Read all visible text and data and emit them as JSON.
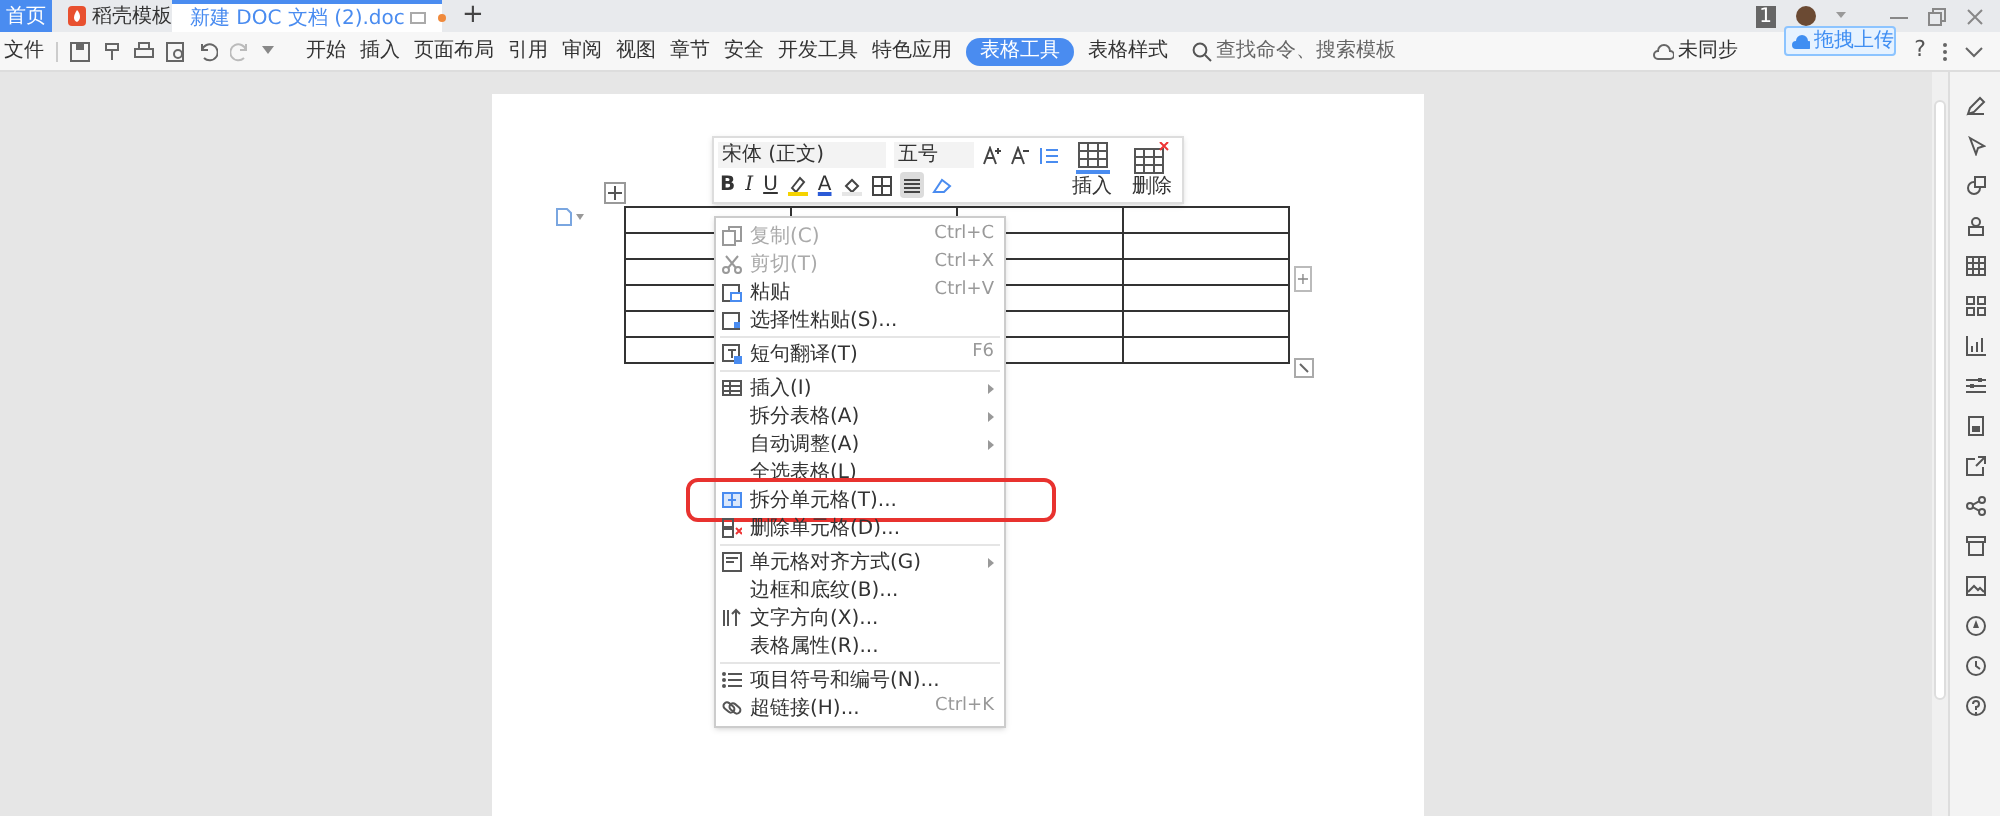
{
  "tabs": [
    {
      "label": "首页",
      "selected": false,
      "kind": "home"
    },
    {
      "label": "稻壳模板",
      "selected": false,
      "kind": "docer"
    },
    {
      "label": "新建 DOC 文档 (2).doc",
      "selected": true,
      "kind": "doc"
    }
  ],
  "new_tab": "+",
  "add_column": "+",
  "account": {
    "badge": "1"
  },
  "toolbar": {
    "file_menu": "文件",
    "ribbon_tabs": [
      {
        "label": "开始",
        "selected": false
      },
      {
        "label": "插入",
        "selected": false
      },
      {
        "label": "页面布局",
        "selected": false
      },
      {
        "label": "引用",
        "selected": false
      },
      {
        "label": "审阅",
        "selected": false
      },
      {
        "label": "视图",
        "selected": false
      },
      {
        "label": "章节",
        "selected": false
      },
      {
        "label": "安全",
        "selected": false
      },
      {
        "label": "开发工具",
        "selected": false
      },
      {
        "label": "特色应用",
        "selected": false
      },
      {
        "label": "表格工具",
        "selected": true
      },
      {
        "label": "表格样式",
        "selected": false
      }
    ],
    "search": {
      "placeholder": "查找命令、搜索模板"
    },
    "sync": "未同步",
    "help": "?"
  },
  "upload_popup": {
    "label": "拖拽上传"
  },
  "mini_toolbar": {
    "font": "宋体 (正文)",
    "size": "五号",
    "insert": "插入",
    "delete": "删除",
    "buttons": [
      {
        "kind": "bold",
        "label": "B",
        "selected": false
      },
      {
        "kind": "italic",
        "label": "I",
        "selected": false
      },
      {
        "kind": "underline",
        "label": "U",
        "selected": false
      },
      {
        "kind": "highlight",
        "selected": false
      },
      {
        "kind": "font_color",
        "label": "A",
        "selected": false
      },
      {
        "kind": "shading",
        "selected": false
      },
      {
        "kind": "borders",
        "selected": false
      },
      {
        "kind": "align",
        "selected": true
      },
      {
        "kind": "eraser",
        "selected": false
      }
    ]
  },
  "context_menu": {
    "items": [
      {
        "kind": "item",
        "label": "复制(C)",
        "shortcut": "Ctrl+C",
        "disabled": true,
        "submenu": false,
        "highlighted": false
      },
      {
        "kind": "item",
        "label": "剪切(T)",
        "shortcut": "Ctrl+X",
        "disabled": true,
        "submenu": false,
        "highlighted": false
      },
      {
        "kind": "item",
        "label": "粘贴",
        "shortcut": "Ctrl+V",
        "disabled": false,
        "submenu": false,
        "highlighted": false
      },
      {
        "kind": "item",
        "label": "选择性粘贴(S)...",
        "disabled": false,
        "submenu": false,
        "highlighted": false
      },
      {
        "kind": "separator"
      },
      {
        "kind": "item",
        "label": "短句翻译(T)",
        "shortcut": "F6",
        "disabled": false,
        "submenu": false,
        "highlighted": false
      },
      {
        "kind": "separator"
      },
      {
        "kind": "item",
        "label": "插入(I)",
        "disabled": false,
        "submenu": true,
        "highlighted": false
      },
      {
        "kind": "item",
        "label": "拆分表格(A)",
        "disabled": false,
        "submenu": true,
        "highlighted": false
      },
      {
        "kind": "item",
        "label": "自动调整(A)",
        "disabled": false,
        "submenu": true,
        "highlighted": false
      },
      {
        "kind": "item",
        "label": "全选表格(L)",
        "disabled": false,
        "submenu": false,
        "highlighted": false
      },
      {
        "kind": "item",
        "label": "拆分单元格(T)...",
        "disabled": false,
        "submenu": false,
        "highlighted": true
      },
      {
        "kind": "item",
        "label": "删除单元格(D)...",
        "disabled": false,
        "submenu": false,
        "highlighted": false
      },
      {
        "kind": "separator"
      },
      {
        "kind": "item",
        "label": "单元格对齐方式(G)",
        "disabled": false,
        "submenu": true,
        "highlighted": false
      },
      {
        "kind": "item",
        "label": "边框和底纹(B)...",
        "disabled": false,
        "submenu": false,
        "highlighted": false
      },
      {
        "kind": "item",
        "label": "文字方向(X)...",
        "disabled": false,
        "submenu": false,
        "highlighted": false
      },
      {
        "kind": "item",
        "label": "表格属性(R)...",
        "disabled": false,
        "submenu": false,
        "highlighted": false
      },
      {
        "kind": "separator"
      },
      {
        "kind": "item",
        "label": "项目符号和编号(N)...",
        "disabled": false,
        "submenu": false,
        "highlighted": false
      },
      {
        "kind": "item",
        "label": "超链接(H)...",
        "shortcut": "Ctrl+K",
        "disabled": false,
        "submenu": false,
        "highlighted": false
      }
    ]
  }
}
